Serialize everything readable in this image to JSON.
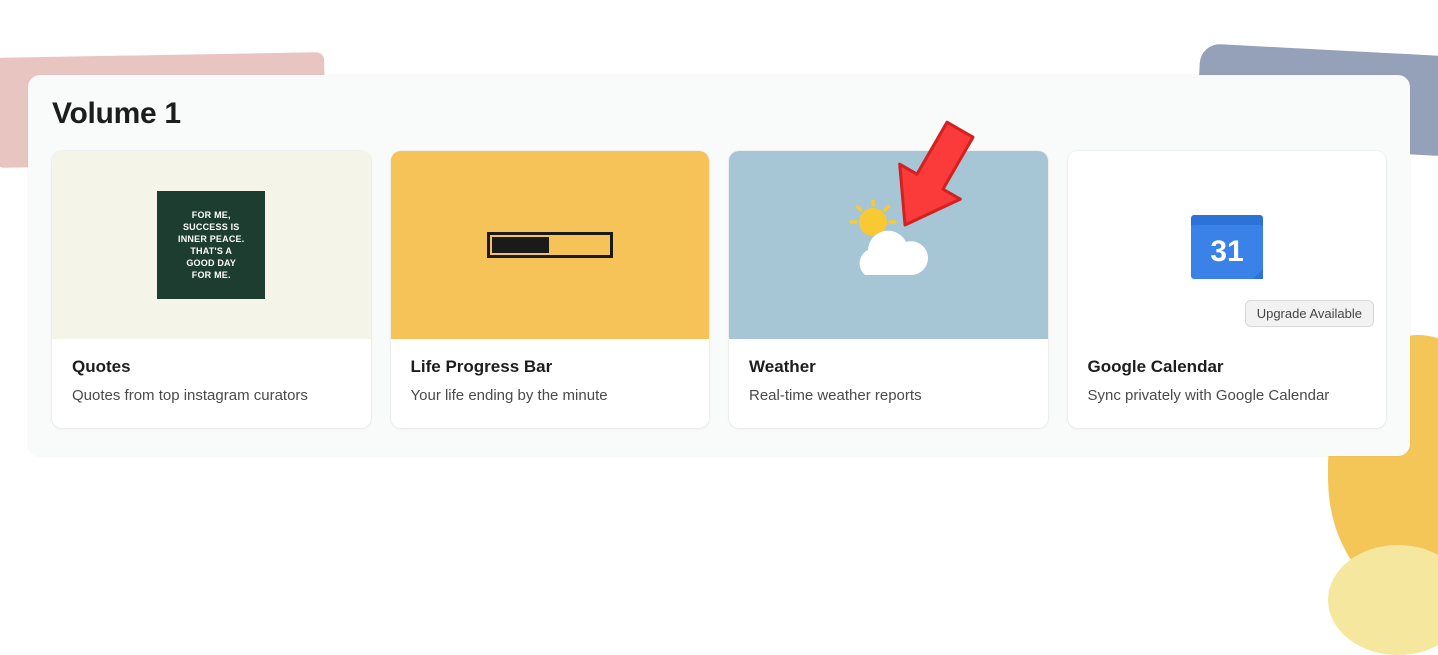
{
  "section": {
    "title": "Volume 1"
  },
  "cards": [
    {
      "title": "Quotes",
      "description": "Quotes from top instagram curators",
      "quote_text": "FOR ME,\nSUCCESS IS\nINNER PEACE.\nTHAT'S A\nGOOD DAY\nFOR ME."
    },
    {
      "title": "Life Progress Bar",
      "description": "Your life ending by the minute"
    },
    {
      "title": "Weather",
      "description": "Real-time weather reports"
    },
    {
      "title": "Google Calendar",
      "description": "Sync privately with Google Calendar",
      "badge": "Upgrade Available",
      "calendar_day": "31"
    }
  ]
}
